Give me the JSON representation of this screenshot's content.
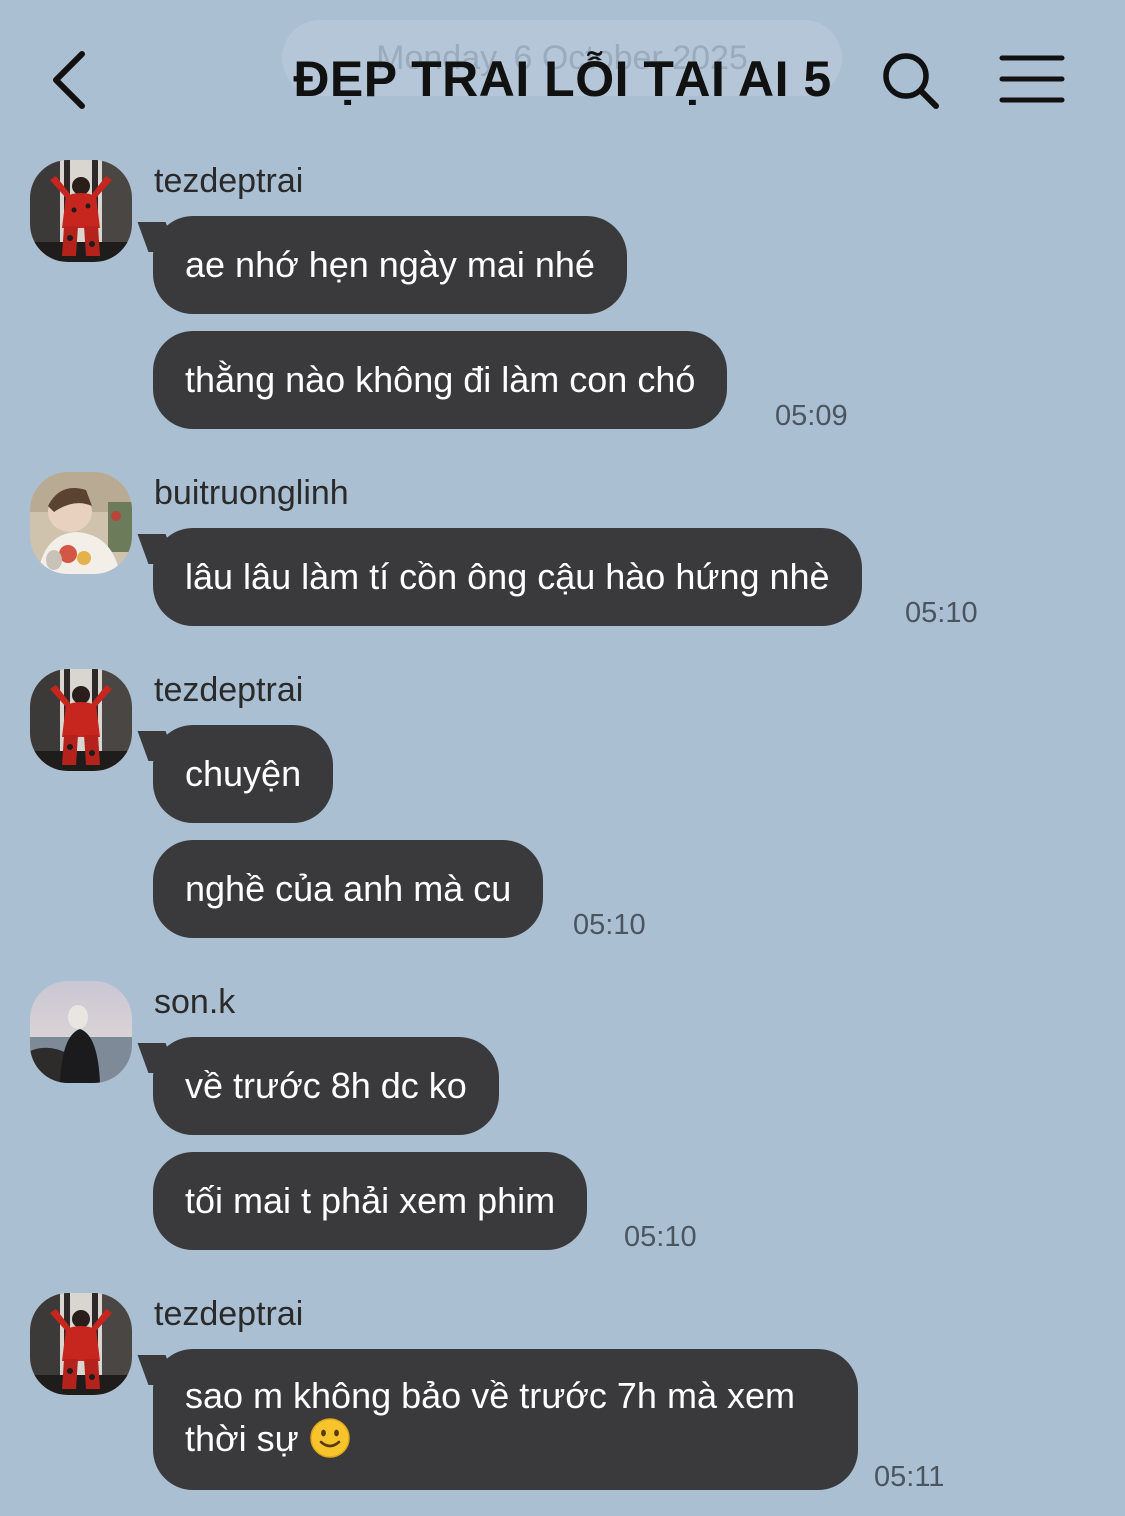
{
  "header": {
    "date_label": "Monday, 6 October 2025",
    "title": "ĐẸP TRAI LỖI TẠI AI 5"
  },
  "messages": [
    {
      "sender": "tezdeptrai",
      "bubbles": [
        "ae nhớ hẹn ngày mai nhé",
        "thằng nào không đi làm con chó"
      ],
      "time": "05:09"
    },
    {
      "sender": "buitruonglinh",
      "bubbles": [
        "lâu lâu làm tí cồn ông cậu hào hứng nhè"
      ],
      "time": "05:10"
    },
    {
      "sender": "tezdeptrai",
      "bubbles": [
        "chuyện",
        "nghề của anh mà cu"
      ],
      "time": "05:10"
    },
    {
      "sender": "son.k",
      "bubbles": [
        "về trước 8h dc ko",
        "tối mai t phải xem phim"
      ],
      "time": "05:10"
    },
    {
      "sender": "tezdeptrai",
      "bubbles": [
        "sao m không bảo về trước 7h mà xem",
        "thời sự"
      ],
      "time": "05:11"
    }
  ],
  "icons": {
    "back": "chevron-left-icon",
    "search": "search-icon",
    "menu": "hamburger-menu-icon",
    "emoji": "slightly-smiling-face-emoji"
  },
  "colors": {
    "background": "#aabfd2",
    "bubble": "#3a3a3d",
    "bubble_text": "#ffffff"
  }
}
